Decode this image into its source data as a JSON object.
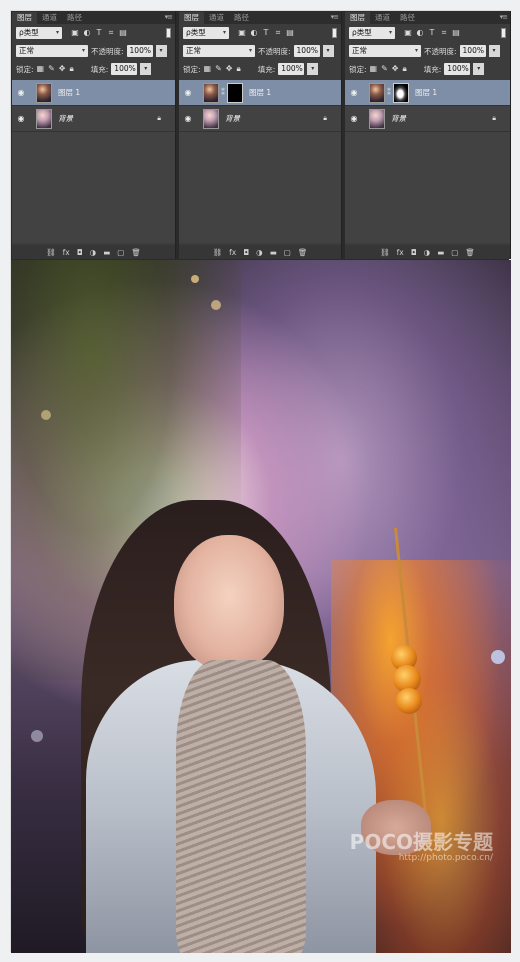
{
  "panels": [
    {
      "tabs": [
        "图层",
        "通道",
        "路径"
      ],
      "filter_label": "ρ类型",
      "blend_mode": "正常",
      "opacity_label": "不透明度:",
      "opacity_value": "100%",
      "lock_label": "锁定:",
      "fill_label": "填充:",
      "fill_value": "100%",
      "layers": [
        {
          "name": "图层 1",
          "selected": true,
          "mask": "none"
        },
        {
          "name": "背景",
          "selected": false,
          "locked": true
        }
      ]
    },
    {
      "tabs": [
        "图层",
        "通道",
        "路径"
      ],
      "filter_label": "ρ类型",
      "blend_mode": "正常",
      "opacity_label": "不透明度:",
      "opacity_value": "100%",
      "lock_label": "锁定:",
      "fill_label": "填充:",
      "fill_value": "100%",
      "layers": [
        {
          "name": "图层 1",
          "selected": true,
          "mask": "black"
        },
        {
          "name": "背景",
          "selected": false,
          "locked": true
        }
      ]
    },
    {
      "tabs": [
        "图层",
        "通道",
        "路径"
      ],
      "filter_label": "ρ类型",
      "blend_mode": "正常",
      "opacity_label": "不透明度:",
      "opacity_value": "100%",
      "lock_label": "锁定:",
      "fill_label": "填充:",
      "fill_value": "100%",
      "layers": [
        {
          "name": "图层 1",
          "selected": true,
          "mask": "white"
        },
        {
          "name": "背景",
          "selected": false,
          "locked": true
        }
      ]
    }
  ],
  "photo": {
    "watermark_brand": "POCO摄影专题",
    "watermark_url": "http://photo.poco.cn/"
  }
}
